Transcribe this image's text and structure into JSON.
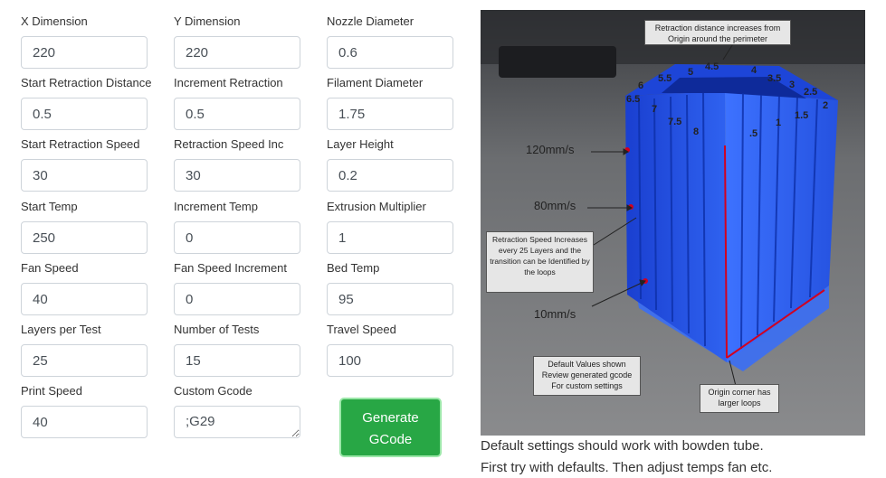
{
  "form": {
    "x_dimension": {
      "label": "X Dimension",
      "value": "220"
    },
    "y_dimension": {
      "label": "Y Dimension",
      "value": "220"
    },
    "nozzle_diameter": {
      "label": "Nozzle Diameter",
      "value": "0.6"
    },
    "start_retraction_distance": {
      "label": "Start Retraction Distance",
      "value": "0.5"
    },
    "increment_retraction": {
      "label": "Increment Retraction",
      "value": "0.5"
    },
    "filament_diameter": {
      "label": "Filament Diameter",
      "value": "1.75"
    },
    "start_retraction_speed": {
      "label": "Start Retraction Speed",
      "value": "30"
    },
    "retraction_speed_inc": {
      "label": "Retraction Speed Inc",
      "value": "30"
    },
    "layer_height": {
      "label": "Layer Height",
      "value": "0.2"
    },
    "start_temp": {
      "label": "Start Temp",
      "value": "250"
    },
    "increment_temp": {
      "label": "Increment Temp",
      "value": "0"
    },
    "extrusion_multiplier": {
      "label": "Extrusion Multiplier",
      "value": "1"
    },
    "fan_speed": {
      "label": "Fan Speed",
      "value": "40"
    },
    "fan_speed_increment": {
      "label": "Fan Speed Increment",
      "value": "0"
    },
    "bed_temp": {
      "label": "Bed Temp",
      "value": "95"
    },
    "layers_per_test": {
      "label": "Layers per Test",
      "value": "25"
    },
    "number_of_tests": {
      "label": "Number of Tests",
      "value": "15"
    },
    "travel_speed": {
      "label": "Travel Speed",
      "value": "100"
    },
    "print_speed": {
      "label": "Print Speed",
      "value": "40"
    },
    "custom_gcode": {
      "label": "Custom Gcode",
      "value": ";G29"
    },
    "generate_button_line1": "Generate",
    "generate_button_line2": "GCode"
  },
  "photo": {
    "callout_top": "Retraction distance increases from Origin around the perimeter",
    "callout_speed": "Retraction Speed Increases every 25 Layers and the transition can be Identified by the loops",
    "callout_defaults": "Default Values shown Review generated gcode For custom settings",
    "callout_origin": "Origin corner has larger loops",
    "speed_120": "120mm/s",
    "speed_80": "80mm/s",
    "speed_10": "10mm/s",
    "distance_labels": [
      "6",
      "5.5",
      "5",
      "4.5",
      "4",
      "3.5",
      "3",
      "2.5",
      "2",
      "1.5",
      "1",
      ".5",
      "6.5",
      "7",
      "7.5",
      "8"
    ]
  },
  "captions": {
    "line1": "Default settings should work with bowden tube.",
    "line2": "First try with defaults. Then adjust temps fan etc."
  },
  "colors": {
    "button_green": "#28a745",
    "print_blue": "#1f4fd9",
    "marker_red": "#d1001f"
  }
}
